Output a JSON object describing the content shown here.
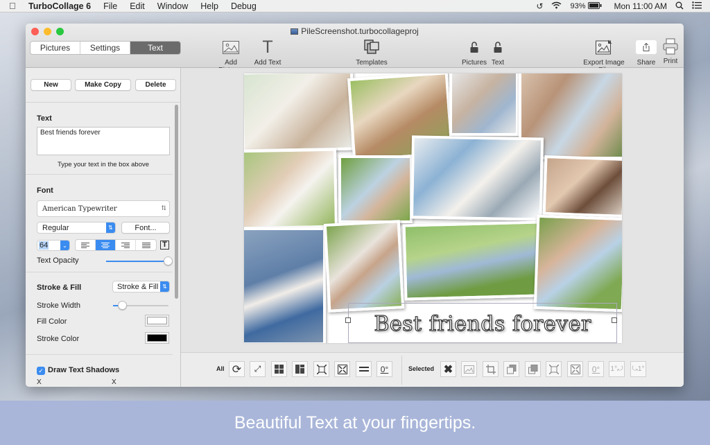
{
  "menubar": {
    "app_name": "TurboCollage 6",
    "menus": [
      "File",
      "Edit",
      "Window",
      "Help",
      "Debug"
    ],
    "battery": "93%",
    "clock": "Mon 11:00 AM",
    "icons": [
      "apple-icon",
      "time-machine-icon",
      "wifi-icon",
      "battery-icon",
      "spotlight-icon",
      "notification-center-icon"
    ]
  },
  "window": {
    "title": "PileScreenshot.turbocollageproj",
    "tabs": [
      {
        "label": "Pictures",
        "active": false
      },
      {
        "label": "Settings",
        "active": false
      },
      {
        "label": "Text",
        "active": true
      }
    ],
    "toolbar": {
      "add_pictures": "Add Pictures",
      "add_text": "Add Text",
      "templates": "Templates",
      "lock_pictures": "Pictures",
      "lock_text": "Text",
      "export": "Export Image File",
      "share": "Share",
      "print": "Print"
    }
  },
  "sidebar": {
    "buttons": {
      "new": "New",
      "make_copy": "Make Copy",
      "delete": "Delete"
    },
    "text_section": {
      "header": "Text",
      "value": "Best friends forever",
      "hint": "Type your text in the box above"
    },
    "font_section": {
      "header": "Font",
      "family": "American Typewriter",
      "style": "Regular",
      "font_button": "Font...",
      "size": "64",
      "alignment_options": [
        "left",
        "center",
        "right",
        "justify"
      ],
      "alignment_selected": "center",
      "opacity_label": "Text Opacity",
      "opacity_value": 1.0
    },
    "stroke_section": {
      "header": "Stroke & Fill",
      "mode": "Stroke & Fill",
      "stroke_width_label": "Stroke Width",
      "stroke_width_value": 0.17,
      "fill_color_label": "Fill Color",
      "fill_color": "#ffffff",
      "stroke_color_label": "Stroke Color",
      "stroke_color": "#000000"
    },
    "shadow_section": {
      "label": "Draw Text Shadows",
      "checked": true,
      "x_label_1": "X",
      "x_label_2": "X"
    }
  },
  "canvas": {
    "caption": "Best friends forever"
  },
  "bottombar": {
    "all_label": "All",
    "all_tools": [
      "shuffle-icon",
      "fit-all-icon",
      "grid-icon",
      "mosaic-icon",
      "expand-icon",
      "shrink-icon",
      "equal-size-icon",
      "rotate-zero-icon"
    ],
    "rotate_zero": "0°",
    "selected_label": "Selected",
    "selected_tools": [
      "remove-icon",
      "replace-image-icon",
      "crop-icon",
      "send-backward-icon",
      "bring-forward-icon",
      "expand-icon",
      "shrink-icon",
      "rotate-zero-icon",
      "rotate-cw-icon",
      "rotate-ccw-icon"
    ],
    "rot_cw": "1°",
    "rot_ccw": "1°"
  },
  "banner": {
    "text": "Beautiful Text at your fingertips."
  }
}
